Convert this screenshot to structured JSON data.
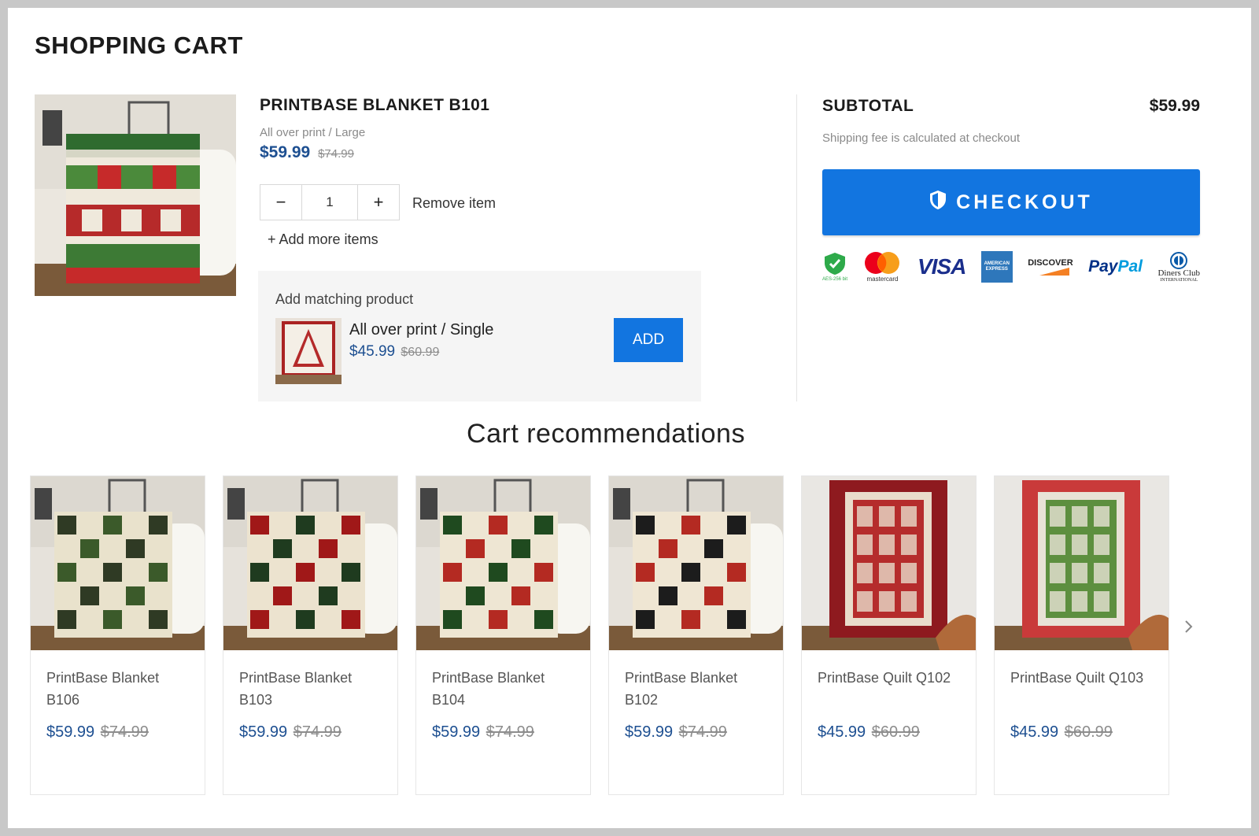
{
  "page": {
    "title": "SHOPPING CART"
  },
  "cart_item": {
    "name": "PRINTBASE BLANKET B101",
    "variant": "All over print / Large",
    "price": "$59.99",
    "compare_price": "$74.99",
    "quantity": "1",
    "minus_label": "−",
    "plus_label": "+",
    "remove_label": "Remove item",
    "add_more_label": "+ Add more items"
  },
  "matching": {
    "title": "Add matching product",
    "variant": "All over print / Single",
    "price": "$45.99",
    "compare_price": "$60.99",
    "add_label": "ADD"
  },
  "summary": {
    "subtotal_label": "SUBTOTAL",
    "subtotal_value": "$59.99",
    "shipping_note": "Shipping fee is calculated at checkout",
    "checkout_label": "CHECKOUT",
    "secure_text": "AES-256 bit",
    "mastercard_text": "mastercard",
    "visa_text": "VISA",
    "amex_line1": "AMERICAN",
    "amex_line2": "EXPRESS",
    "discover_text": "DISCOVER",
    "paypal_a": "Pay",
    "paypal_b": "Pal",
    "diners_line1": "Diners Club",
    "diners_line2": "INTERNATIONAL"
  },
  "recommendations": {
    "title": "Cart recommendations",
    "items": [
      {
        "name": "PrintBase Blanket B106",
        "price": "$59.99",
        "compare": "$74.99",
        "colors": [
          "#2f3a24",
          "#e9e2cc",
          "#3b5a2a"
        ]
      },
      {
        "name": "PrintBase Blanket B103",
        "price": "$59.99",
        "compare": "$74.99",
        "colors": [
          "#a01818",
          "#ece3cf",
          "#1f3b1f"
        ]
      },
      {
        "name": "PrintBase Blanket B104",
        "price": "$59.99",
        "compare": "$74.99",
        "colors": [
          "#1f4a1f",
          "#eee6d3",
          "#b42a22"
        ]
      },
      {
        "name": "PrintBase Blanket B102",
        "price": "$59.99",
        "compare": "$74.99",
        "colors": [
          "#1c1c1c",
          "#efe6d3",
          "#b42a22"
        ]
      },
      {
        "name": "PrintBase Quilt Q102",
        "price": "$45.99",
        "compare": "$60.99",
        "colors": [
          "#8e1a1f",
          "#e9dccb",
          "#b52c2c"
        ]
      },
      {
        "name": "PrintBase Quilt Q103",
        "price": "$45.99",
        "compare": "$60.99",
        "colors": [
          "#c93a3a",
          "#e8e2d6",
          "#5d8f3f"
        ]
      }
    ]
  },
  "colors": {
    "accent": "#1275e0",
    "price_blue": "#1d4f91"
  }
}
